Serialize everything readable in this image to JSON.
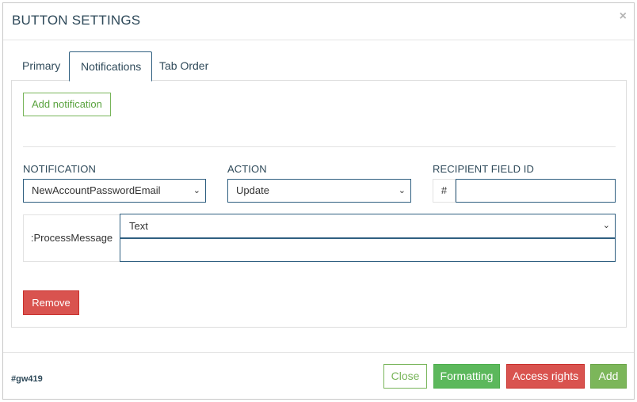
{
  "modal": {
    "title": "BUTTON SETTINGS",
    "close_glyph": "×"
  },
  "tabs": [
    {
      "label": "Primary",
      "active": false
    },
    {
      "label": "Notifications",
      "active": true
    },
    {
      "label": "Tab Order",
      "active": false
    }
  ],
  "notifications": {
    "add_label": "Add notification",
    "notification_label": "NOTIFICATION",
    "notification_value": "NewAccountPasswordEmail",
    "action_label": "ACTION",
    "action_value": "Update",
    "recipient_label": "RECIPIENT FIELD ID",
    "recipient_prefix": "#",
    "recipient_value": "",
    "param_label": ":ProcessMessage",
    "param_type_value": "Text",
    "param_text_value": "",
    "remove_label": "Remove"
  },
  "footer": {
    "id_text": "#gw419",
    "close_label": "Close",
    "formatting_label": "Formatting",
    "access_label": "Access rights",
    "add_label": "Add"
  },
  "icons": {
    "dropdown": "chevron-down-icon",
    "close": "close-icon"
  },
  "colors": {
    "primary_border": "#2f5f80",
    "title_text": "#2f4a5a",
    "success": "#5cb85c",
    "success_light": "#7cb65a",
    "danger": "#d9534f",
    "outline_green": "#78b55a"
  }
}
